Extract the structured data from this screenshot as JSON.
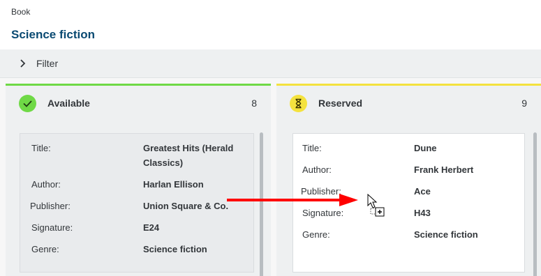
{
  "breadcrumb": "Book",
  "page_title": "Science fiction",
  "filter": {
    "label": "Filter",
    "icon": "chevron-right-icon"
  },
  "columns": [
    {
      "title": "Available",
      "count": "8",
      "color": "#6fd946",
      "icon": "check-icon",
      "card": {
        "fields": [
          {
            "label": "Title:",
            "value": "Greatest Hits (Herald Classics)"
          },
          {
            "label": "Author:",
            "value": "Harlan Ellison"
          },
          {
            "label": "Publisher:",
            "value": "Union Square & Co."
          },
          {
            "label": "Signature:",
            "value": "E24"
          },
          {
            "label": "Genre:",
            "value": "Science fiction"
          }
        ]
      }
    },
    {
      "title": "Reserved",
      "count": "9",
      "color": "#f4e23e",
      "icon": "hourglass-icon",
      "card": {
        "fields": [
          {
            "label": "Title:",
            "value": "Dune"
          },
          {
            "label": "Author:",
            "value": "Frank Herbert"
          },
          {
            "label": "Publisher:",
            "value": "Ace"
          },
          {
            "label": "Signature:",
            "value": "H43"
          },
          {
            "label": "Genre:",
            "value": "Science fiction"
          }
        ]
      }
    }
  ],
  "annotation": {
    "arrow_color": "#ff0000",
    "cursor": "drag-copy-cursor-icon"
  }
}
